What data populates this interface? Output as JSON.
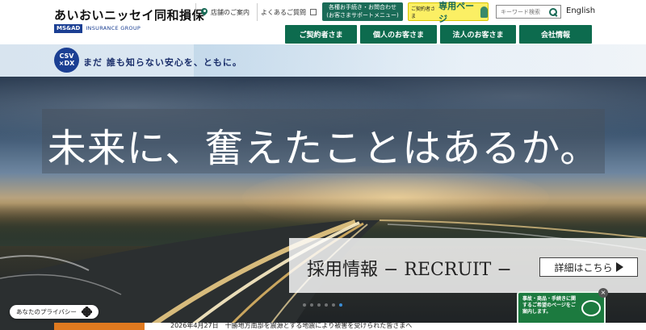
{
  "header": {
    "logo_main": "あいおいニッセイ同和損保",
    "logo_msad": "MS&AD",
    "logo_group": "INSURANCE GROUP",
    "store_info": "店舗のご案内",
    "faq": "よくあるご質問",
    "support_line1": "各種お手続き・お問合わせ",
    "support_line2": "(お客さまサポートメニュー)",
    "mypage_small": "ご契約者さま",
    "mypage_big": "専用ページ",
    "search_placeholder": "キーワード検索",
    "english": "English"
  },
  "nav": {
    "items": [
      {
        "label": "ご契約者さま"
      },
      {
        "label": "個人のお客さま"
      },
      {
        "label": "法人のお客さま"
      },
      {
        "label": "会社情報"
      }
    ]
  },
  "band": {
    "badge_line1": "CSV",
    "badge_line2": "×DX",
    "tagline": "まだ 誰も知らない安心を、ともに。"
  },
  "hero": {
    "headline": "未来に、奮えたことはあるか。",
    "recruit_title": "採用情報 − RECRUIT −",
    "recruit_button": "詳細はこちら",
    "slides_total": 6,
    "slide_active": 6
  },
  "privacy": {
    "label": "あなたのプライバシー"
  },
  "chat": {
    "text": "事故・商品・手続きに関するご希望のページをご案内します。",
    "close": "×"
  },
  "news": {
    "text": "2026年4月27日　十勝地方南部を震源とする地震により被害を受けられた皆さまへ"
  },
  "colors": {
    "brand_green": "#0d6b4e",
    "brand_navy": "#1b3f93",
    "mypage_yellow": "#fbef64",
    "news_orange": "#e07a1f",
    "chat_green": "#1c7a3f"
  }
}
